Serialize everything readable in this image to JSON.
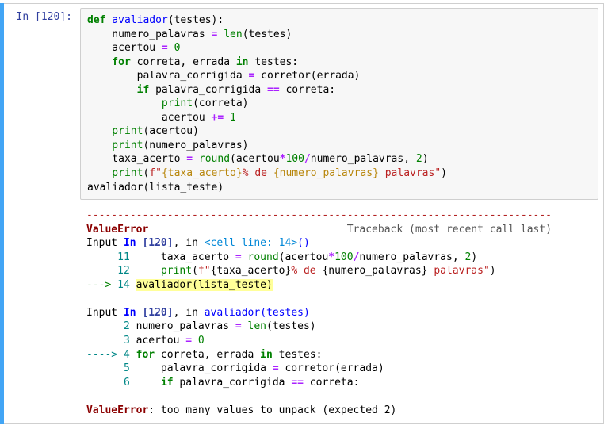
{
  "prompt": {
    "label": "In [120]:"
  },
  "code": {
    "l1_def": "def",
    "l1_fn": " avaliador",
    "l1_rest": "(testes):",
    "l2a": "    numero_palavras ",
    "l2op": "=",
    "l2b": " ",
    "l2len": "len",
    "l2c": "(testes)",
    "l3a": "    acertou ",
    "l3op": "=",
    "l3b": " ",
    "l3num": "0",
    "l4for": "    for",
    "l4a": " correta, errada ",
    "l4in": "in",
    "l4b": " testes:",
    "l5a": "        palavra_corrigida ",
    "l5op": "=",
    "l5b": " corretor(errada)",
    "l6if": "        if",
    "l6a": " palavra_corrigida ",
    "l6eq": "==",
    "l6b": " correta:",
    "l7print": "            print",
    "l7a": "(correta)",
    "l8a": "            acertou ",
    "l8op": "+=",
    "l8b": " ",
    "l8num": "1",
    "l9print": "    print",
    "l9a": "(acertou)",
    "l10print": "    print",
    "l10a": "(numero_palavras)",
    "l11a": "    taxa_acerto ",
    "l11op": "=",
    "l11b": " ",
    "l11round": "round",
    "l11c": "(acertou",
    "l11star": "*",
    "l11n100": "100",
    "l11slash": "/",
    "l11d": "numero_palavras, ",
    "l11n2": "2",
    "l11e": ")",
    "l12print": "    print",
    "l12a": "(",
    "l12f": "f\"",
    "l12s1": "{taxa_acerto}",
    "l12t1": "% de ",
    "l12s2": "{numero_palavras}",
    "l12t2": " palavras\"",
    "l12b": ")",
    "l13": "",
    "l14": "avaliador(lista_teste)"
  },
  "output": {
    "sep": "---------------------------------------------------------------------------",
    "err": "ValueError",
    "tb": "                                Traceback (most recent call last)",
    "r1a": "Input ",
    "r1in": "In ",
    "r1bo": "[",
    "r1num": "120",
    "r1bc": "]",
    "r1b": ", in ",
    "r1cell": "<cell line: 14>",
    "r1paren": "()",
    "r2ln": "     11",
    "r2a": "     taxa_acerto ",
    "r2op": "=",
    "r2b": " ",
    "r2round": "round",
    "r2c": "(acertou",
    "r2star": "*",
    "r2n100": "100",
    "r2slash": "/",
    "r2d": "numero_palavras, ",
    "r2n2": "2",
    "r2e": ")",
    "r3ln": "     12",
    "r3a": "     ",
    "r3print": "print",
    "r3b": "(",
    "r3f": "f\"",
    "r3s1": "{taxa_acerto}",
    "r3t1": "% de ",
    "r3s2": "{numero_palavras}",
    "r3t2": " palavras\"",
    "r3c": ")",
    "r4arrow": "---> ",
    "r4ln": "14",
    "r4sp": " ",
    "r4hl": "avaliador(lista_teste)",
    "r5a": "Input ",
    "r5in": "In ",
    "r5bo": "[",
    "r5num": "120",
    "r5bc": "]",
    "r5b": ", in ",
    "r5fn": "avaliador",
    "r5args": "(testes)",
    "r6ln": "      2",
    "r6a": " numero_palavras ",
    "r6op": "=",
    "r6b": " ",
    "r6len": "len",
    "r6c": "(testes)",
    "r7ln": "      3",
    "r7a": " acertou ",
    "r7op": "=",
    "r7b": " ",
    "r7num": "0",
    "r8arrow": "----> ",
    "r8ln": "4",
    "r8sp": " ",
    "r8for": "for",
    "r8a": " correta, errada ",
    "r8in": "in",
    "r8b": " testes:",
    "r9ln": "      5",
    "r9a": "     palavra_corrigida ",
    "r9op": "=",
    "r9b": " corretor(errada)",
    "r10ln": "      6",
    "r10a": "     ",
    "r10if": "if",
    "r10b": " palavra_corrigida ",
    "r10eq": "==",
    "r10c": " correta:",
    "rfinal": ": too many values to unpack (expected 2)"
  }
}
